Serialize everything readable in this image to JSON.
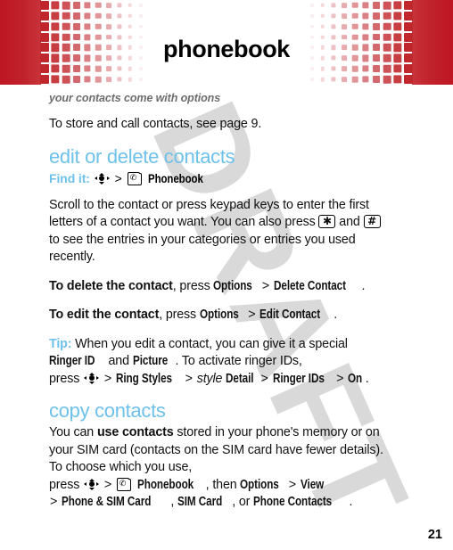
{
  "header": {
    "title": "phonebook",
    "accent_red": "#c0272d",
    "pattern_columns": 10,
    "pattern_rows": 8
  },
  "watermark": {
    "text": "DRAFT",
    "color": "#d9d9d9"
  },
  "document": {
    "subtitle": "your contacts come with options",
    "intro": "To store and call contacts, see page 9.",
    "accent_blue": "#6ec1ea",
    "page_number": "21"
  },
  "sections": [
    {
      "heading": "edit or delete contacts",
      "findit": {
        "label": "Find it:",
        "nav_icon": "navigation-key-icon",
        "separator": ">",
        "app_icon": "phonebook-icon",
        "target": "Phonebook"
      },
      "paragraph_1a": "Scroll to the contact or press keypad keys to enter the first letters of a contact you want. You can also press",
      "key_star": "✱",
      "paragraph_1b": "and",
      "key_hash": "#",
      "paragraph_1c": "to see the entries in your categories or entries you used recently.",
      "delete_lead": "To delete the contact",
      "delete_rest": ", press",
      "delete_menu_1": "Options",
      "delete_menu_2": "Delete Contact",
      "edit_lead": "To edit the contact",
      "edit_rest": ", press",
      "edit_menu_1": "Options",
      "edit_menu_2": "Edit Contact",
      "tip_label": "Tip:",
      "tip_text_1": "When you edit a contact, you can give it a special",
      "tip_menu_1": "Ringer ID",
      "tip_and": "and",
      "tip_menu_2": "Picture",
      "tip_text_2": ". To activate ringer IDs,",
      "tip_press": "press",
      "tip_menu_3": "Ring Styles",
      "tip_italic": "style",
      "tip_menu_4": "Detail",
      "tip_menu_5": "Ringer IDs",
      "tip_menu_6": "On"
    },
    {
      "heading": "copy contacts",
      "copy_text_1": "You can",
      "copy_bold_1": "use contacts",
      "copy_text_2": "stored in your phone's memory or on your SIM card (contacts on the SIM card have fewer details). To choose which you use,",
      "copy_press": "press",
      "copy_target": "Phonebook",
      "copy_then": ", then",
      "copy_menu_options": "Options",
      "copy_menu_view": "View",
      "copy_menu_psim": "Phone & SIM Card",
      "copy_menu_sim": "SIM Card",
      "copy_or": ", or",
      "copy_menu_pc": "Phone Contacts",
      "copy_period": "."
    }
  ]
}
